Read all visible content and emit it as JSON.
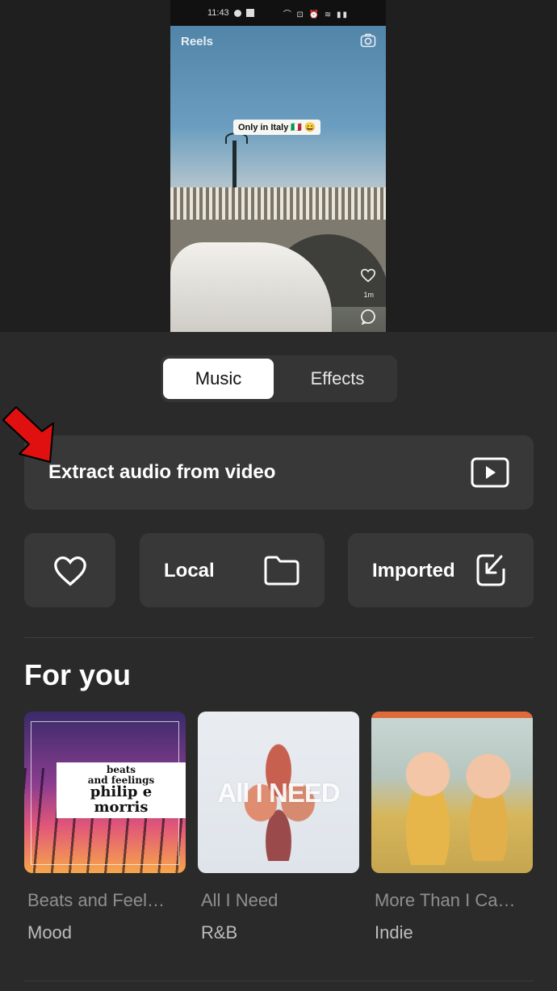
{
  "video": {
    "status_time": "11:43",
    "reels_label": "Reels",
    "caption": "Only in Italy 🇮🇹 😄",
    "like_count": "1m"
  },
  "tabs": {
    "music": "Music",
    "effects": "Effects",
    "selected": "Music"
  },
  "extract": {
    "label": "Extract audio from video"
  },
  "sources": {
    "local": "Local",
    "imported": "Imported"
  },
  "for_you": {
    "title": "For you",
    "tracks": [
      {
        "title": "Beats and Feel…",
        "genre": "Mood",
        "cover_text_line1": "beats",
        "cover_text_line2": "and feelings",
        "cover_text_line3": "philip e morris"
      },
      {
        "title": "All I Need",
        "genre": "R&B",
        "cover_text": "All I NEED"
      },
      {
        "title": "More Than I Ca…",
        "genre": "Indie"
      }
    ]
  },
  "colors": {
    "background": "#2a2a2a",
    "card": "#383838",
    "annotation_arrow": "#e01010"
  }
}
